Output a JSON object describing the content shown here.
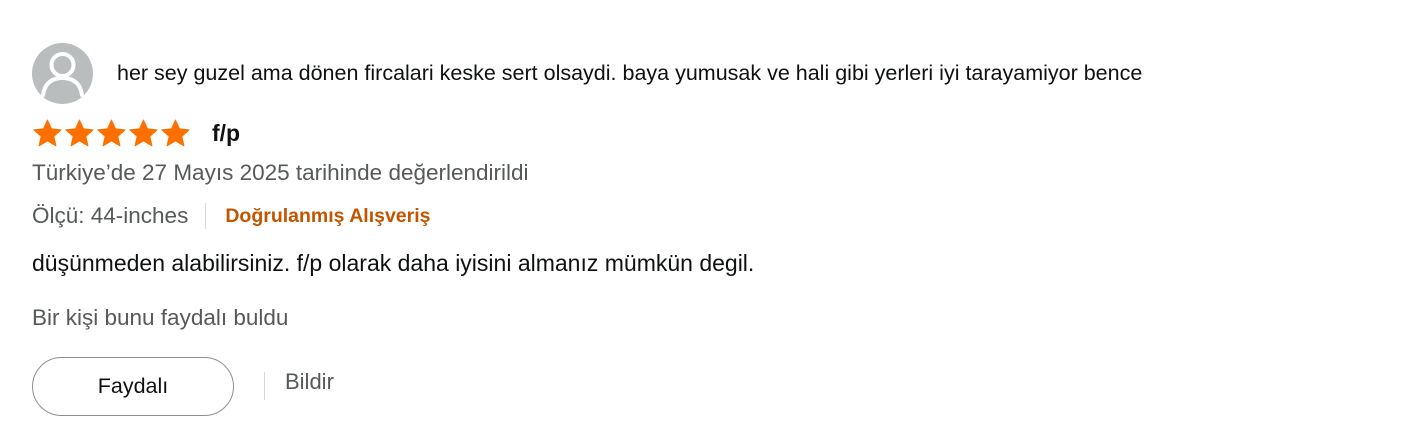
{
  "review": {
    "profile": {
      "name": "her sey guzel ama dönen fircalari keske sert olsaydi. baya yumusak ve hali gibi yerleri iyi tarayamiyor bence",
      "avatar_icon": "default-user-avatar-icon"
    },
    "rating": {
      "stars": 5,
      "max_stars": 5,
      "star_color": "#ff6f00",
      "star_icon": "star-icon"
    },
    "title": "f/p",
    "date_text": "Türkiye’de 27 Mayıs 2025 tarihinde değerlendirildi",
    "size_text": "Ölçü: 44-inches",
    "verified_text": "Doğrulanmış Alışveriş",
    "verified_color": "#c45500",
    "body": "düşünmeden alabilirsiniz. f/p olarak daha iyisini almanız mümkün degil.",
    "helpful_count_text": "Bir kişi bunu faydalı buldu",
    "helpful_button_label": "Faydalı",
    "report_label": "Bildir"
  }
}
